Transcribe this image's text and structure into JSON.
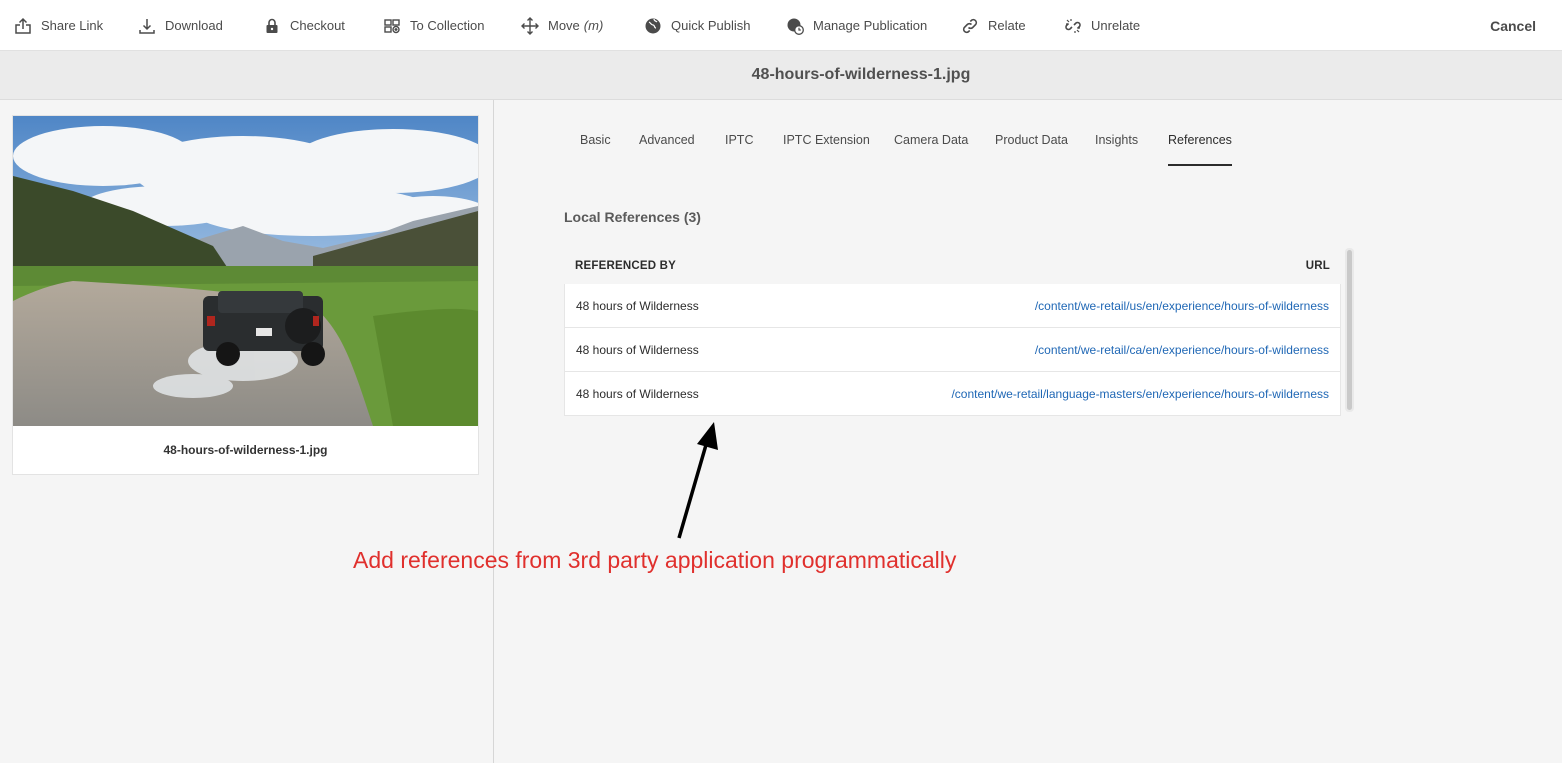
{
  "toolbar": {
    "items": [
      {
        "label": "Share Link",
        "icon": "share-icon"
      },
      {
        "label": "Download",
        "icon": "download-icon"
      },
      {
        "label": "Checkout",
        "icon": "lock-icon"
      },
      {
        "label": "To Collection",
        "icon": "add-to-collection-icon"
      },
      {
        "label": "Move",
        "shortcut": "(m)",
        "icon": "move-icon"
      },
      {
        "label": "Quick Publish",
        "icon": "globe-icon"
      },
      {
        "label": "Manage Publication",
        "icon": "globe-clock-icon"
      },
      {
        "label": "Relate",
        "icon": "link-icon"
      },
      {
        "label": "Unrelate",
        "icon": "unlink-icon"
      }
    ],
    "cancel_label": "Cancel"
  },
  "title": "48-hours-of-wilderness-1.jpg",
  "asset_card": {
    "name": "48-hours-of-wilderness-1.jpg"
  },
  "tabs": [
    "Basic",
    "Advanced",
    "IPTC",
    "IPTC Extension",
    "Camera Data",
    "Product Data",
    "Insights",
    "References"
  ],
  "active_tab": "References",
  "references": {
    "title": "Local References (3)",
    "columns": [
      "REFERENCED BY",
      "URL"
    ],
    "rows": [
      {
        "by": "48 hours of Wilderness",
        "url": "/content/we-retail/us/en/experience/hours-of-wilderness"
      },
      {
        "by": "48 hours of Wilderness",
        "url": "/content/we-retail/ca/en/experience/hours-of-wilderness"
      },
      {
        "by": "48 hours of Wilderness",
        "url": "/content/we-retail/language-masters/en/experience/hours-of-wilderness"
      }
    ]
  },
  "annotation": "Add references from 3rd party application programmatically",
  "colors": {
    "link": "#1f67b5",
    "annotation": "#e0302d"
  }
}
